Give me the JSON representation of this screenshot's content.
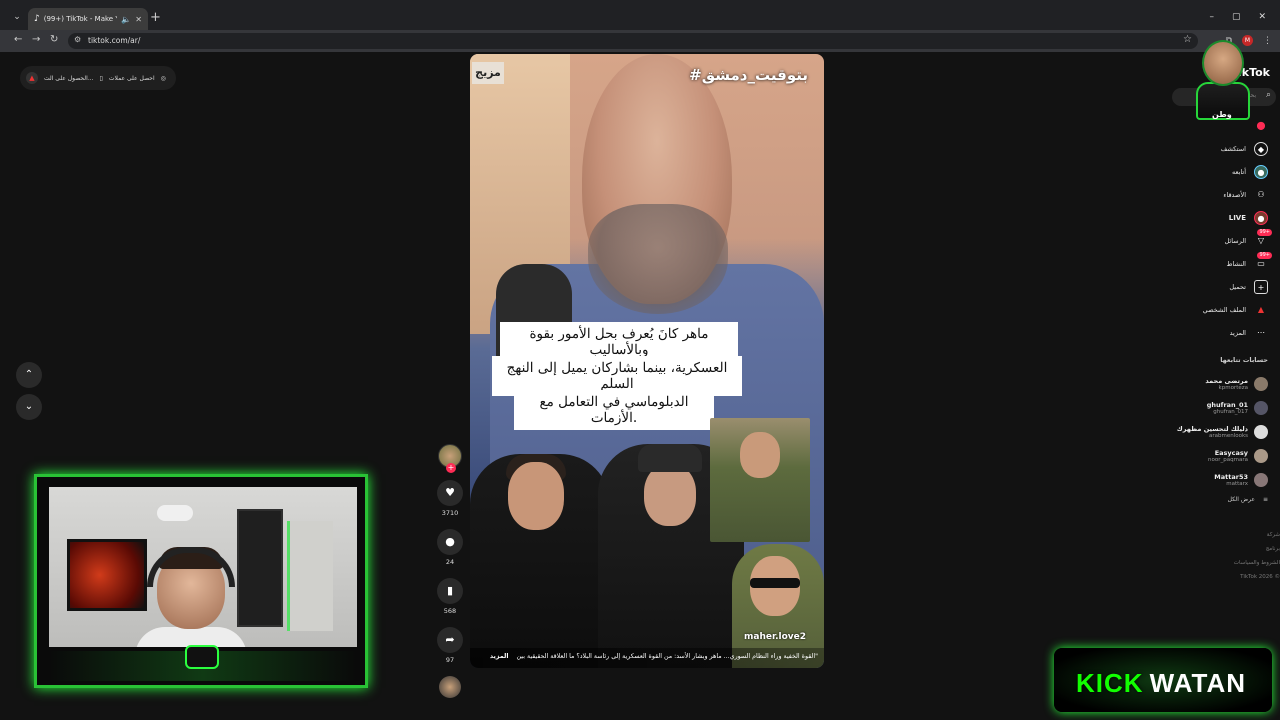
{
  "browser": {
    "tab_title": "(99+) TikTok - Make Your D",
    "url": "tiktok.com/ar/",
    "new_tab": "+"
  },
  "promo": {
    "item1": "احصل على عملات",
    "item2": "الحصول على الت..."
  },
  "video": {
    "brand": "مزيج",
    "hashtag": "#بتوقيت_دمشق",
    "caption_line1": "ماهر كانَ يُعرف بحل الأمور بقوة وبالأساليب",
    "caption_line2": "العسكرية، بينما بشاركان يميل إلى النهج السلم",
    "caption_line3": "الدبلوماسي في التعامل مع الأزمات.",
    "handle": "maher.love2",
    "description": "\"القوة الخفية وراء النظام السوري... ماهر وبشار الأسد: من القوة العسكرية إلى رئاسة البلاد؟ ما العلاقة الحقيقية بين",
    "more": "المزيد"
  },
  "actions": {
    "likes": "3710",
    "comments": "24",
    "saves": "568",
    "shares": "97"
  },
  "sidebar": {
    "logo": "TikTok",
    "search_placeholder": "بحث",
    "nav": [
      {
        "label": "استكشف",
        "icon": "compass-icon"
      },
      {
        "label": "أتابعه",
        "icon": "following-icon"
      },
      {
        "label": "الأصدقاء",
        "icon": "friends-icon"
      },
      {
        "label": "LIVE",
        "icon": "live-icon"
      },
      {
        "label": "الرسائل",
        "icon": "messages-icon",
        "badge": "99+"
      },
      {
        "label": "النشاط",
        "icon": "activity-icon",
        "badge": "99+"
      },
      {
        "label": "تحميل",
        "icon": "upload-icon"
      },
      {
        "label": "الملف الشخصي",
        "icon": "profile-icon"
      },
      {
        "label": "المزيد",
        "icon": "more-icon"
      }
    ],
    "following_heading": "حسابات تتابعها",
    "accounts": [
      {
        "name": "مرتضى محمد",
        "handle": "kpmorteza"
      },
      {
        "name": "ghufran_01",
        "handle": "ghufran_017"
      },
      {
        "name": "دليلك لتحسين مظهرك",
        "handle": "arabmenlooks"
      },
      {
        "name": "Easycasy",
        "handle": "noor_paqmara"
      },
      {
        "name": "Mattar53",
        "handle": "mattarx"
      }
    ],
    "see_all": "عرض الكل",
    "footer": [
      "شركة",
      "برنامج",
      "الشروط والسياسات",
      "TikTok 2026 ©"
    ]
  },
  "overlay": {
    "badge": "وطن",
    "kick": "KICK",
    "watan": "WATAN"
  }
}
